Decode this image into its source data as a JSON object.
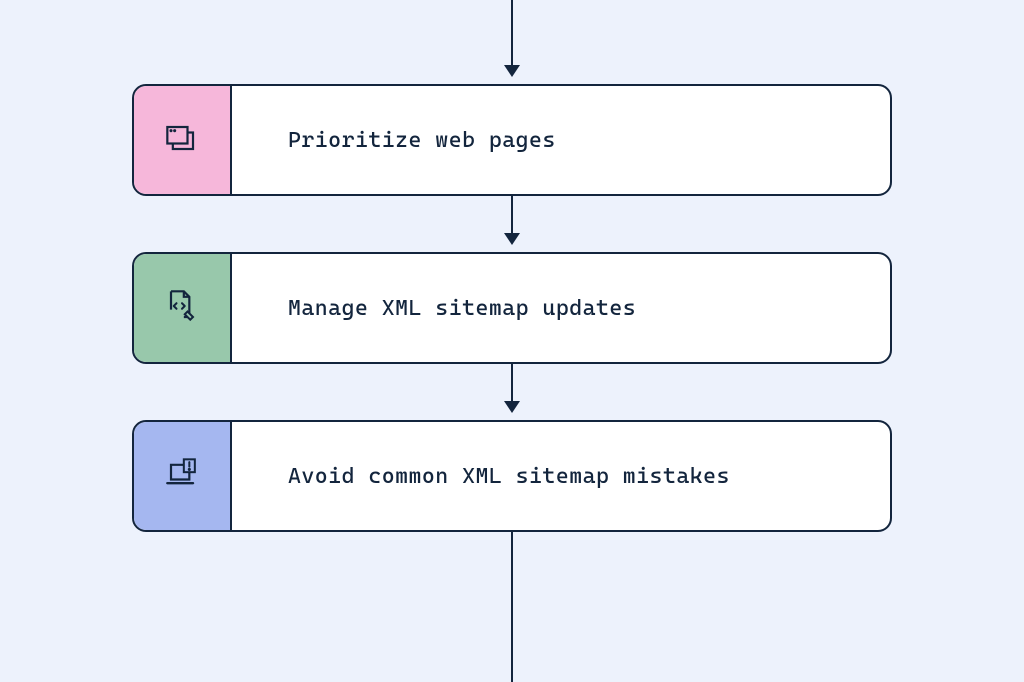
{
  "diagram": {
    "type": "vertical-flowchart",
    "colors": {
      "background": "#edf2fc",
      "stroke": "#13253d",
      "card_bg": "#ffffff",
      "tile_pink": "#f6b7da",
      "tile_green": "#98c8ab",
      "tile_blue": "#a5b7f0"
    },
    "steps": [
      {
        "label": "Prioritize web pages",
        "icon": "windows-stack-icon",
        "tile_color": "pink"
      },
      {
        "label": "Manage XML sitemap updates",
        "icon": "file-code-edit-icon",
        "tile_color": "green"
      },
      {
        "label": "Avoid common XML sitemap mistakes",
        "icon": "laptop-alert-icon",
        "tile_color": "blue"
      }
    ],
    "continues_above": true,
    "continues_below": true
  }
}
